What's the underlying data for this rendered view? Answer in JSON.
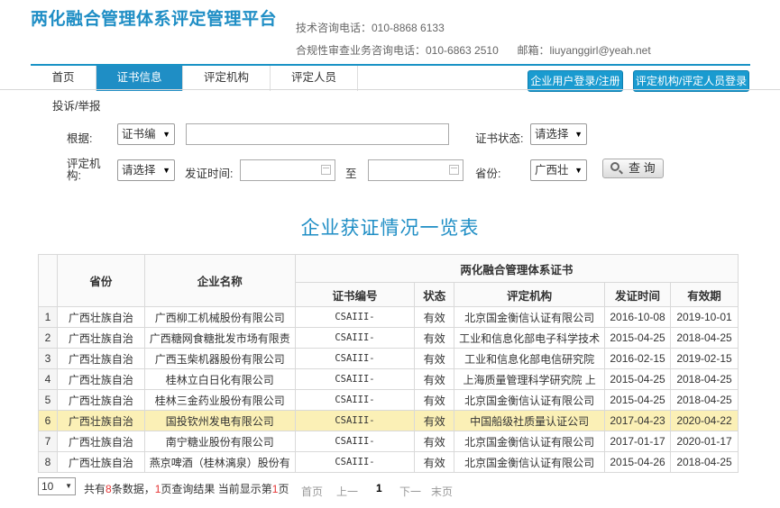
{
  "header": {
    "title": "两化融合管理体系评定管理平台",
    "tech_phone": "技术咨询电话：010-8868 6133",
    "compliance_phone": "合规性审查业务咨询电话：010-6863 2510",
    "email": "邮箱：liuyanggirl@yeah.net"
  },
  "nav": {
    "items": [
      "首页",
      "证书信息",
      "评定机构",
      "评定人员"
    ],
    "active": "证书信息",
    "enterprise_login": "企业用户登录/注册",
    "agency_login": "评定机构/评定人员登录",
    "sub_item": "投诉/举报"
  },
  "form": {
    "basis_label": "根据:",
    "basis_value": "证书编",
    "cert_status_label": "证书状态:",
    "cert_status_value": "请选择",
    "agency_label": "评定机构:",
    "agency_value": "请选择",
    "issue_time_label": "发证时间:",
    "to_label": "至",
    "province_label": "省份:",
    "province_value": "广西壮",
    "query_label": "查 询"
  },
  "section_title": "企业获证情况一览表",
  "table": {
    "group_header": "两化融合管理体系证书",
    "headers": {
      "province": "省份",
      "company": "企业名称",
      "cert_no": "证书编号",
      "status": "状态",
      "agency": "评定机构",
      "issue_date": "发证时间",
      "expiry": "有效期"
    },
    "rows": [
      {
        "idx": "1",
        "province": "广西壮族自治",
        "company": "广西柳工机械股份有限公司",
        "cert_no": "CSAIII-",
        "status": "有效",
        "agency": "北京国金衡信认证有限公司",
        "issue_date": "2016-10-08",
        "expiry": "2019-10-01"
      },
      {
        "idx": "2",
        "province": "广西壮族自治",
        "company": "广西糖网食糖批发市场有限责",
        "cert_no": "CSAIII-",
        "status": "有效",
        "agency": "工业和信息化部电子科学技术",
        "issue_date": "2015-04-25",
        "expiry": "2018-04-25"
      },
      {
        "idx": "3",
        "province": "广西壮族自治",
        "company": "广西玉柴机器股份有限公司",
        "cert_no": "CSAIII-",
        "status": "有效",
        "agency": "工业和信息化部电信研究院",
        "issue_date": "2016-02-15",
        "expiry": "2019-02-15"
      },
      {
        "idx": "4",
        "province": "广西壮族自治",
        "company": "桂林立白日化有限公司",
        "cert_no": "CSAIII-",
        "status": "有效",
        "agency": "上海质量管理科学研究院 上",
        "issue_date": "2015-04-25",
        "expiry": "2018-04-25"
      },
      {
        "idx": "5",
        "province": "广西壮族自治",
        "company": "桂林三金药业股份有限公司",
        "cert_no": "CSAIII-",
        "status": "有效",
        "agency": "北京国金衡信认证有限公司",
        "issue_date": "2015-04-25",
        "expiry": "2018-04-25"
      },
      {
        "idx": "6",
        "province": "广西壮族自治",
        "company": "国投钦州发电有限公司",
        "cert_no": "CSAIII-",
        "status": "有效",
        "agency": "中国船级社质量认证公司",
        "issue_date": "2017-04-23",
        "expiry": "2020-04-22"
      },
      {
        "idx": "7",
        "province": "广西壮族自治",
        "company": "南宁糖业股份有限公司",
        "cert_no": "CSAIII-",
        "status": "有效",
        "agency": "北京国金衡信认证有限公司",
        "issue_date": "2017-01-17",
        "expiry": "2020-01-17"
      },
      {
        "idx": "8",
        "province": "广西壮族自治",
        "company": "燕京啤酒（桂林漓泉）股份有",
        "cert_no": "CSAIII-",
        "status": "有效",
        "agency": "北京国金衡信认证有限公司",
        "issue_date": "2015-04-26",
        "expiry": "2018-04-25"
      }
    ],
    "highlight_row": 6
  },
  "pager": {
    "page_size": "10",
    "total_prefix": "共有",
    "total_count": "8",
    "total_mid": "条数据，",
    "pages_count": "1",
    "pages_mid": "页查询结果  当前显示第",
    "current_page": "1",
    "pages_suffix": "页",
    "first": "首页",
    "prev": "上一",
    "page_num": "1",
    "next": "下一",
    "last": "末页"
  },
  "colors": {
    "accent": "#1f8ec5",
    "highlight_row": "#fbf0b6",
    "count_red": "#e53333"
  }
}
